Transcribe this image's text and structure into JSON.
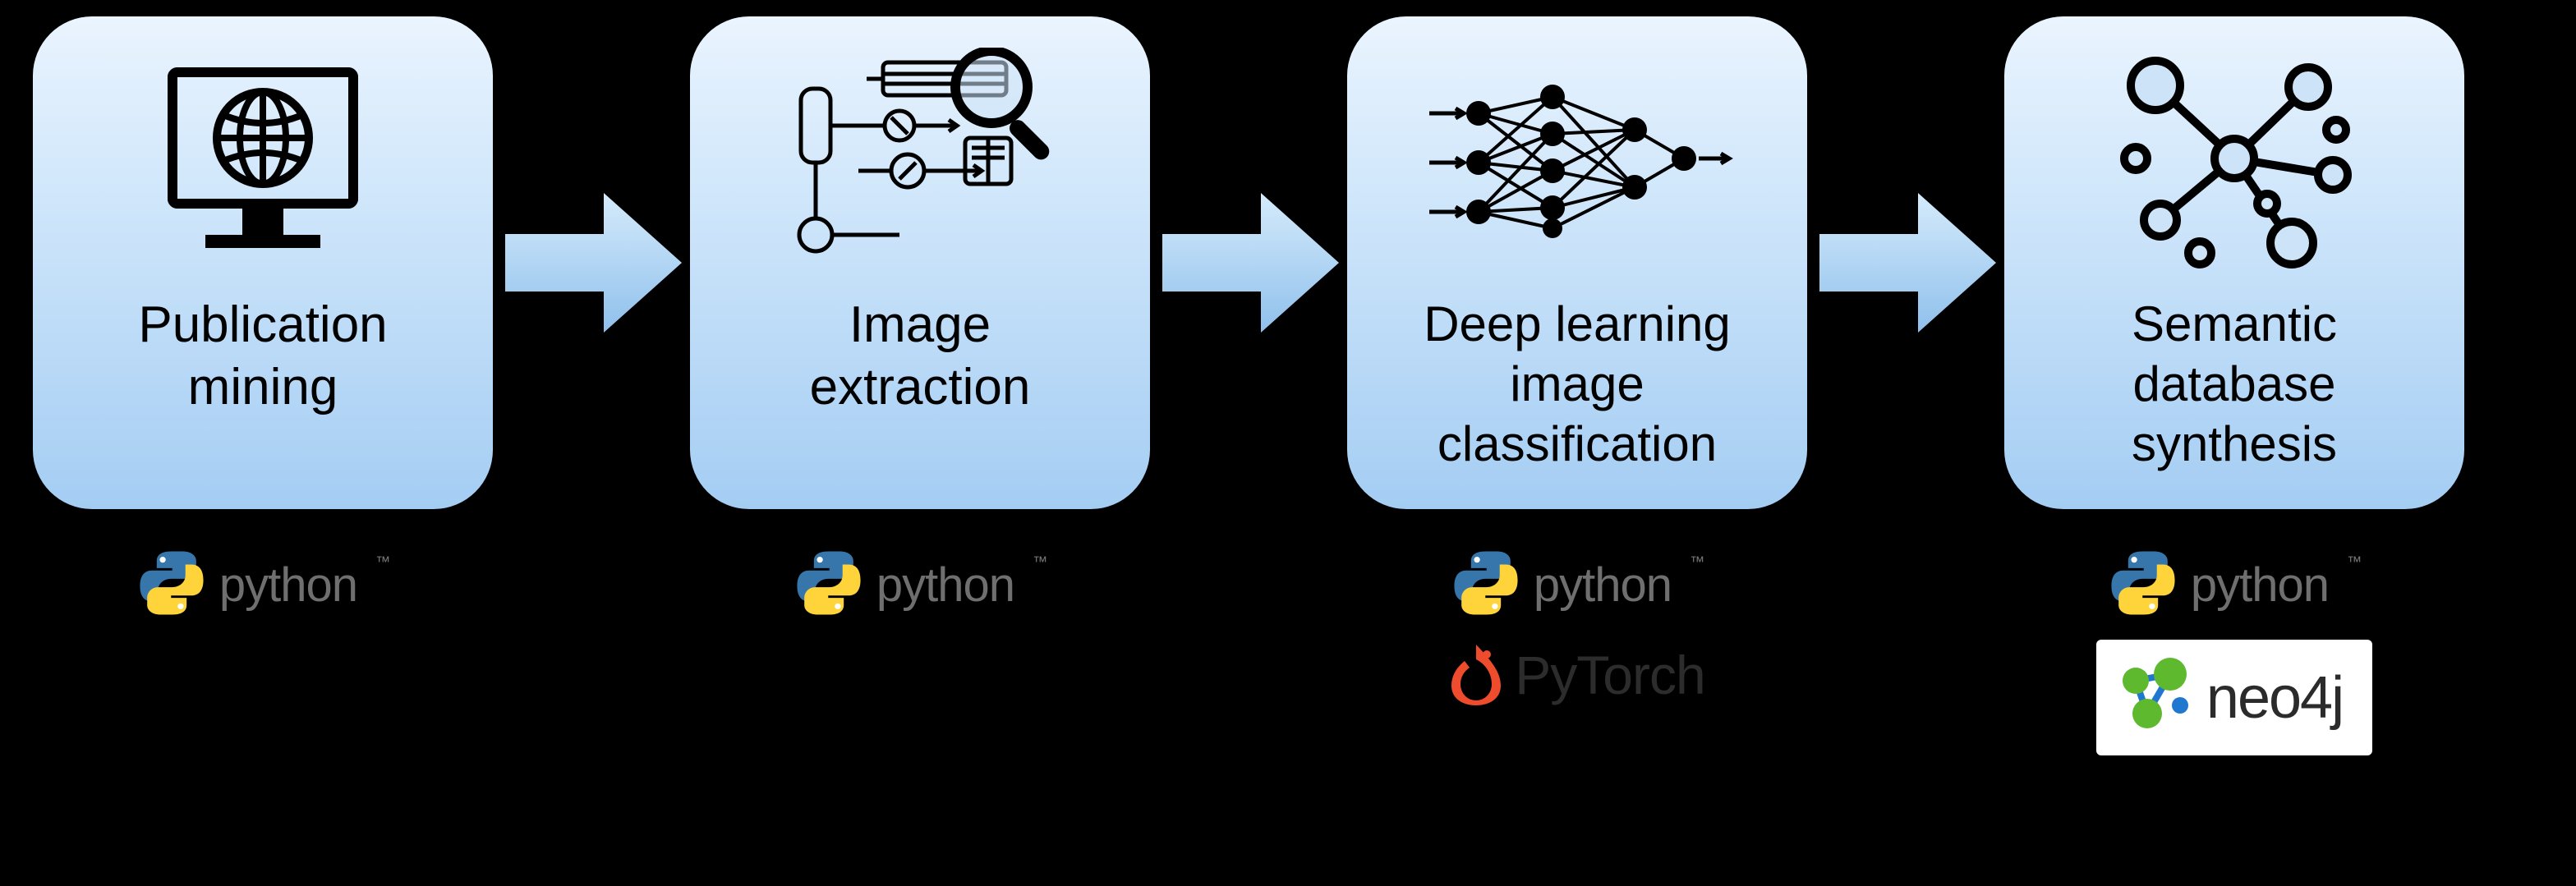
{
  "stages": [
    {
      "title": "Publication\nmining",
      "icon": "monitor-globe"
    },
    {
      "title": "Image\nextraction",
      "icon": "schematic-magnify"
    },
    {
      "title": "Deep learning\nimage\nclassification",
      "icon": "neural-net"
    },
    {
      "title": "Semantic\ndatabase\nsynthesis",
      "icon": "graph-nodes"
    }
  ],
  "logos": {
    "python": "python",
    "python_tm": "™",
    "pytorch": "PyTorch",
    "neo4j": "neo4j"
  },
  "colors": {
    "card_top": "#eaf4fe",
    "card_bottom": "#a4cdf3",
    "arrow": "#9fcaf1",
    "pytorch": "#ee4c2c",
    "neo4j_green": "#5eb92e",
    "neo4j_blue": "#1f77d0"
  }
}
